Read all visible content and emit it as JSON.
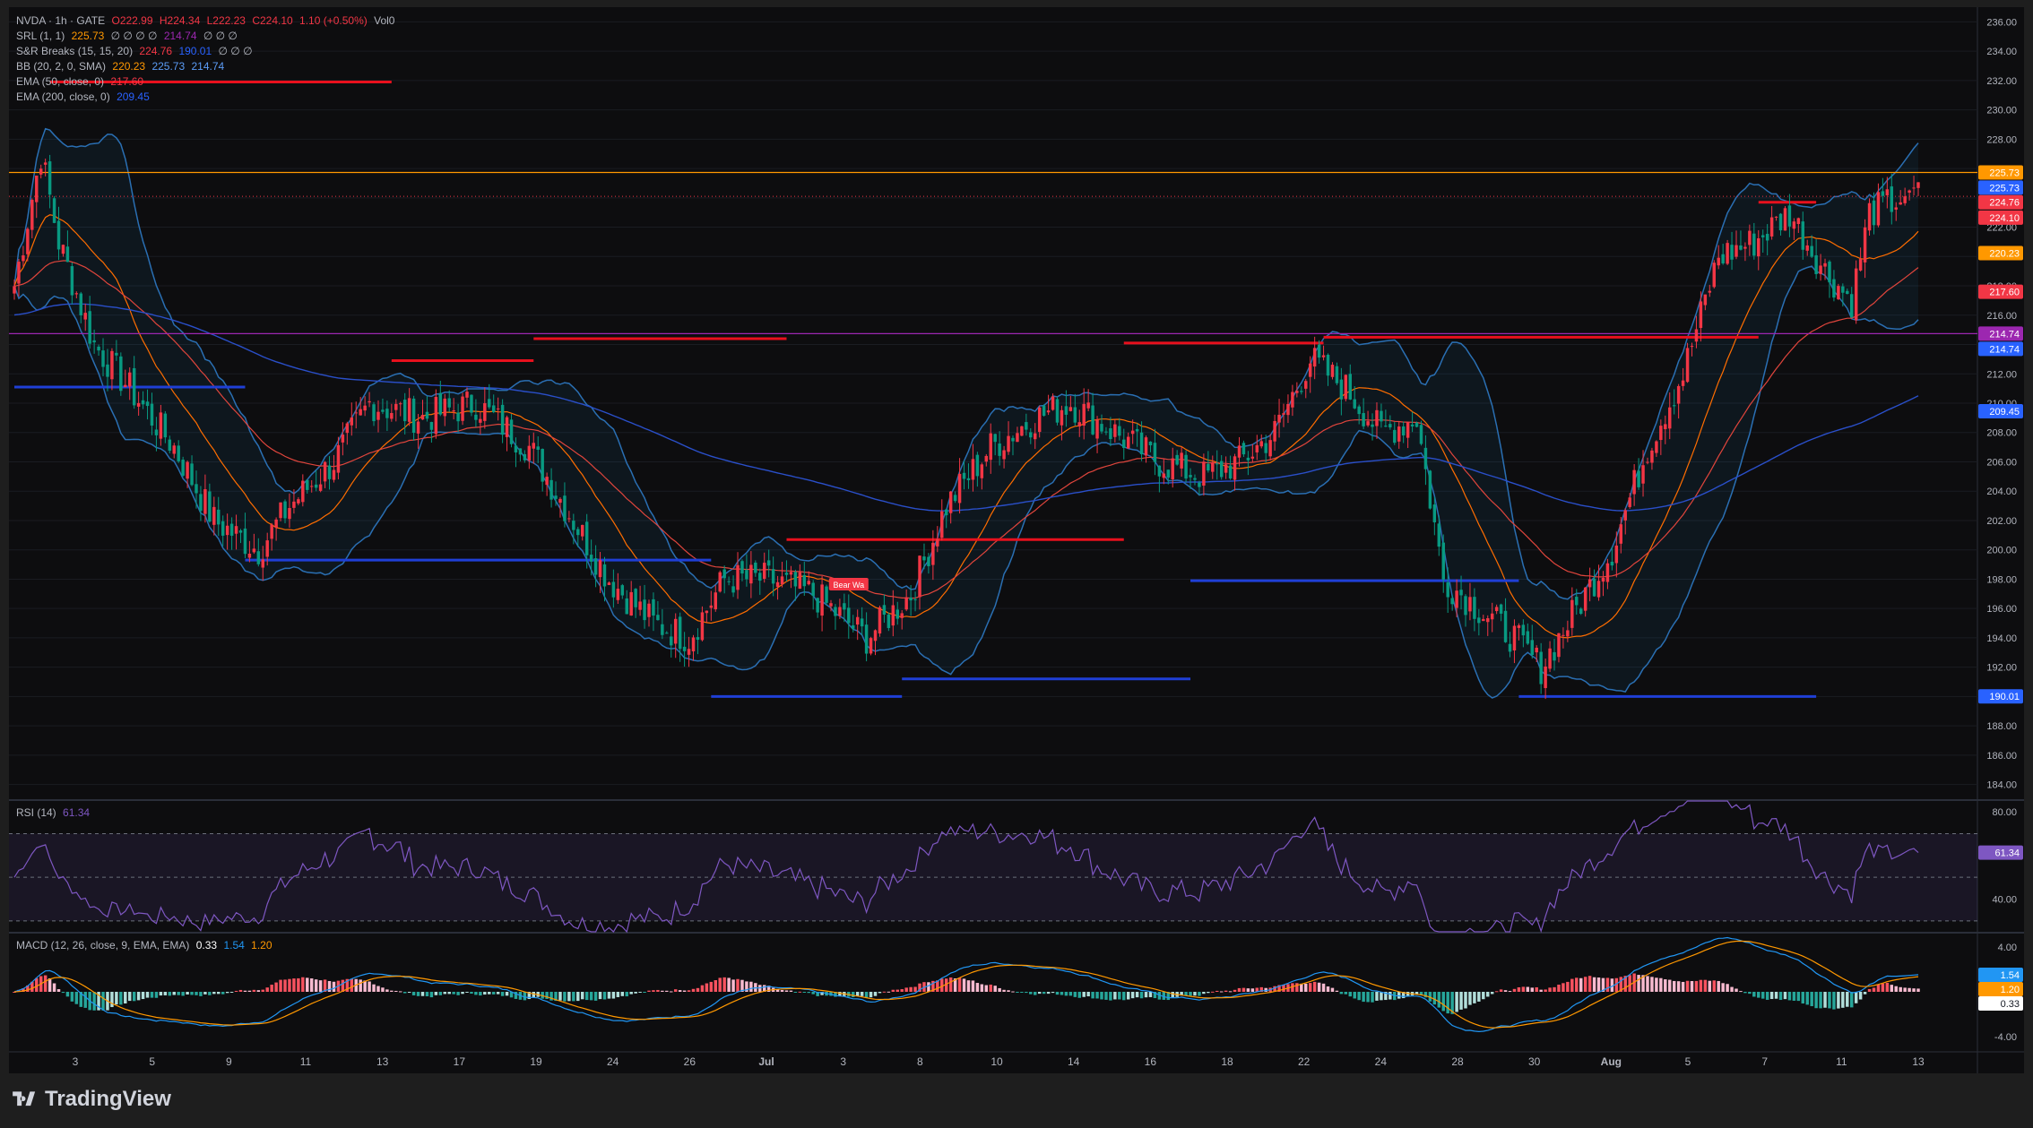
{
  "legend": {
    "symbol_line": {
      "symbol": "NVDA · 1h · GATE",
      "o": "O222.99",
      "h": "H224.34",
      "l": "L222.23",
      "c": "C224.10",
      "chg": "1.10 (+0.50%)",
      "vol": "Vol0"
    },
    "srl": {
      "name": "SRL (1, 1)",
      "v1": "225.73",
      "rest": "∅ ∅ ∅ ∅",
      "v2": "214.74",
      "rest2": "∅ ∅ ∅"
    },
    "snr": {
      "name": "S&R Breaks (15, 15, 20)",
      "v1": "224.76",
      "v2": "190.01",
      "rest": "∅ ∅ ∅"
    },
    "bb": {
      "name": "BB (20, 2, 0, SMA)",
      "v1": "220.23",
      "v2": "225.73",
      "v3": "214.74"
    },
    "ema50": {
      "name": "EMA (50, close, 0)",
      "v": "217.60"
    },
    "ema200": {
      "name": "EMA (200, close, 0)",
      "v": "209.45"
    },
    "rsi": {
      "name": "RSI (14)",
      "v": "61.34"
    },
    "macd": {
      "name": "MACD (12, 26, close, 9, EMA, EMA)",
      "v1": "0.33",
      "v2": "1.54",
      "v3": "1.20"
    }
  },
  "brand": {
    "name": "TradingView"
  },
  "colors": {
    "up": "#f23645",
    "down": "#089981",
    "bb": "#2962ff",
    "ema50": "#f7525f",
    "ema200": "#2962ff",
    "basis": "#ff6d00",
    "srl_top": "#ff9800",
    "srl_mid": "#9c27b0",
    "rsi": "#7e57c2"
  },
  "chart_data": [
    {
      "type": "candlestick",
      "title": "NVDA · 1h · GATE",
      "ylim": [
        183,
        237
      ],
      "y_ticks": [
        "236.00",
        "234.00",
        "232.00",
        "230.00",
        "228.00",
        "222.00",
        "218.00",
        "216.00",
        "212.00",
        "210.00",
        "208.00",
        "206.00",
        "204.00",
        "202.00",
        "200.00",
        "198.00",
        "196.00",
        "194.00",
        "192.00",
        "188.00",
        "186.00",
        "184.00"
      ],
      "x_ticks": [
        "3",
        "5",
        "9",
        "11",
        "13",
        "17",
        "19",
        "24",
        "26",
        "Jul",
        "3",
        "8",
        "10",
        "14",
        "16",
        "18",
        "22",
        "24",
        "28",
        "30",
        "Aug",
        "5",
        "7",
        "11",
        "13"
      ],
      "close_path": [
        {
          "i": 0,
          "c": 218
        },
        {
          "i": 6,
          "c": 227
        },
        {
          "i": 10,
          "c": 221
        },
        {
          "i": 18,
          "c": 214
        },
        {
          "i": 26,
          "c": 211
        },
        {
          "i": 36,
          "c": 207
        },
        {
          "i": 45,
          "c": 202
        },
        {
          "i": 55,
          "c": 200
        },
        {
          "i": 62,
          "c": 203
        },
        {
          "i": 72,
          "c": 206
        },
        {
          "i": 80,
          "c": 210
        },
        {
          "i": 92,
          "c": 209
        },
        {
          "i": 104,
          "c": 210
        },
        {
          "i": 116,
          "c": 207
        },
        {
          "i": 124,
          "c": 203
        },
        {
          "i": 134,
          "c": 198
        },
        {
          "i": 144,
          "c": 195
        },
        {
          "i": 152,
          "c": 194
        },
        {
          "i": 160,
          "c": 198
        },
        {
          "i": 170,
          "c": 198
        },
        {
          "i": 180,
          "c": 197
        },
        {
          "i": 192,
          "c": 194
        },
        {
          "i": 202,
          "c": 197
        },
        {
          "i": 210,
          "c": 203
        },
        {
          "i": 220,
          "c": 207
        },
        {
          "i": 230,
          "c": 209
        },
        {
          "i": 238,
          "c": 210
        },
        {
          "i": 248,
          "c": 208
        },
        {
          "i": 258,
          "c": 206
        },
        {
          "i": 268,
          "c": 205
        },
        {
          "i": 276,
          "c": 206
        },
        {
          "i": 284,
          "c": 208
        },
        {
          "i": 292,
          "c": 213
        },
        {
          "i": 300,
          "c": 211
        },
        {
          "i": 308,
          "c": 208
        },
        {
          "i": 316,
          "c": 209
        },
        {
          "i": 322,
          "c": 198
        },
        {
          "i": 330,
          "c": 196
        },
        {
          "i": 338,
          "c": 194
        },
        {
          "i": 344,
          "c": 192
        },
        {
          "i": 352,
          "c": 196
        },
        {
          "i": 360,
          "c": 200
        },
        {
          "i": 368,
          "c": 207
        },
        {
          "i": 376,
          "c": 212
        },
        {
          "i": 384,
          "c": 220
        },
        {
          "i": 392,
          "c": 221
        },
        {
          "i": 400,
          "c": 223
        },
        {
          "i": 408,
          "c": 219
        },
        {
          "i": 414,
          "c": 217
        },
        {
          "i": 418,
          "c": 223
        },
        {
          "i": 426,
          "c": 224.1
        }
      ],
      "horizontal_levels": [
        {
          "name": "SRL top",
          "value": 225.73
        },
        {
          "name": "last price",
          "value": 224.1
        },
        {
          "name": "SRL mid",
          "value": 214.74
        }
      ],
      "price_labels": [
        {
          "text": "225.73",
          "color": "#ff9800",
          "value": 225.73
        },
        {
          "text": "225.73",
          "color": "#2962ff",
          "value": 224.7
        },
        {
          "text": "224.76",
          "color": "#f23645",
          "value": 223.7
        },
        {
          "text": "224.10",
          "color": "#f23645",
          "value": 222.65
        },
        {
          "text": "220.23",
          "color": "#ff9800",
          "value": 220.23
        },
        {
          "text": "217.60",
          "color": "#f23645",
          "value": 217.6
        },
        {
          "text": "214.74",
          "color": "#9c27b0",
          "value": 214.74
        },
        {
          "text": "214.74",
          "color": "#2962ff",
          "value": 213.7
        },
        {
          "text": "209.45",
          "color": "#2962ff",
          "value": 209.45
        },
        {
          "text": "190.01",
          "color": "#2962ff",
          "value": 190.01
        }
      ],
      "resistance_lines": [
        {
          "y": 231.9,
          "i0": 8,
          "i1": 85
        },
        {
          "y": 212.9,
          "i0": 85,
          "i1": 117
        },
        {
          "y": 214.4,
          "i0": 117,
          "i1": 174
        },
        {
          "y": 200.7,
          "i0": 174,
          "i1": 250
        },
        {
          "y": 214.1,
          "i0": 250,
          "i1": 295
        },
        {
          "y": 214.5,
          "i0": 295,
          "i1": 393
        },
        {
          "y": 223.7,
          "i0": 393,
          "i1": 406
        }
      ],
      "support_lines": [
        {
          "y": 211.1,
          "i0": 0,
          "i1": 52
        },
        {
          "y": 199.3,
          "i0": 52,
          "i1": 157
        },
        {
          "y": 190.0,
          "i0": 157,
          "i1": 200
        },
        {
          "y": 191.2,
          "i0": 200,
          "i1": 265
        },
        {
          "y": 197.9,
          "i0": 265,
          "i1": 339
        },
        {
          "y": 190.0,
          "i0": 339,
          "i1": 406
        }
      ],
      "tags": [
        "Bear Wa"
      ]
    },
    {
      "type": "line",
      "title": "RSI (14)",
      "ylim": [
        25,
        85
      ],
      "y_ticks": [
        "80.00",
        "40.00"
      ],
      "value": 61.34
    },
    {
      "type": "bar",
      "title": "MACD (12, 26, close, 9, EMA, EMA)",
      "y_ticks": [
        "4.00",
        "-4.00"
      ],
      "values": {
        "macd": 1.54,
        "signal": 1.2,
        "hist": 0.33
      }
    }
  ]
}
